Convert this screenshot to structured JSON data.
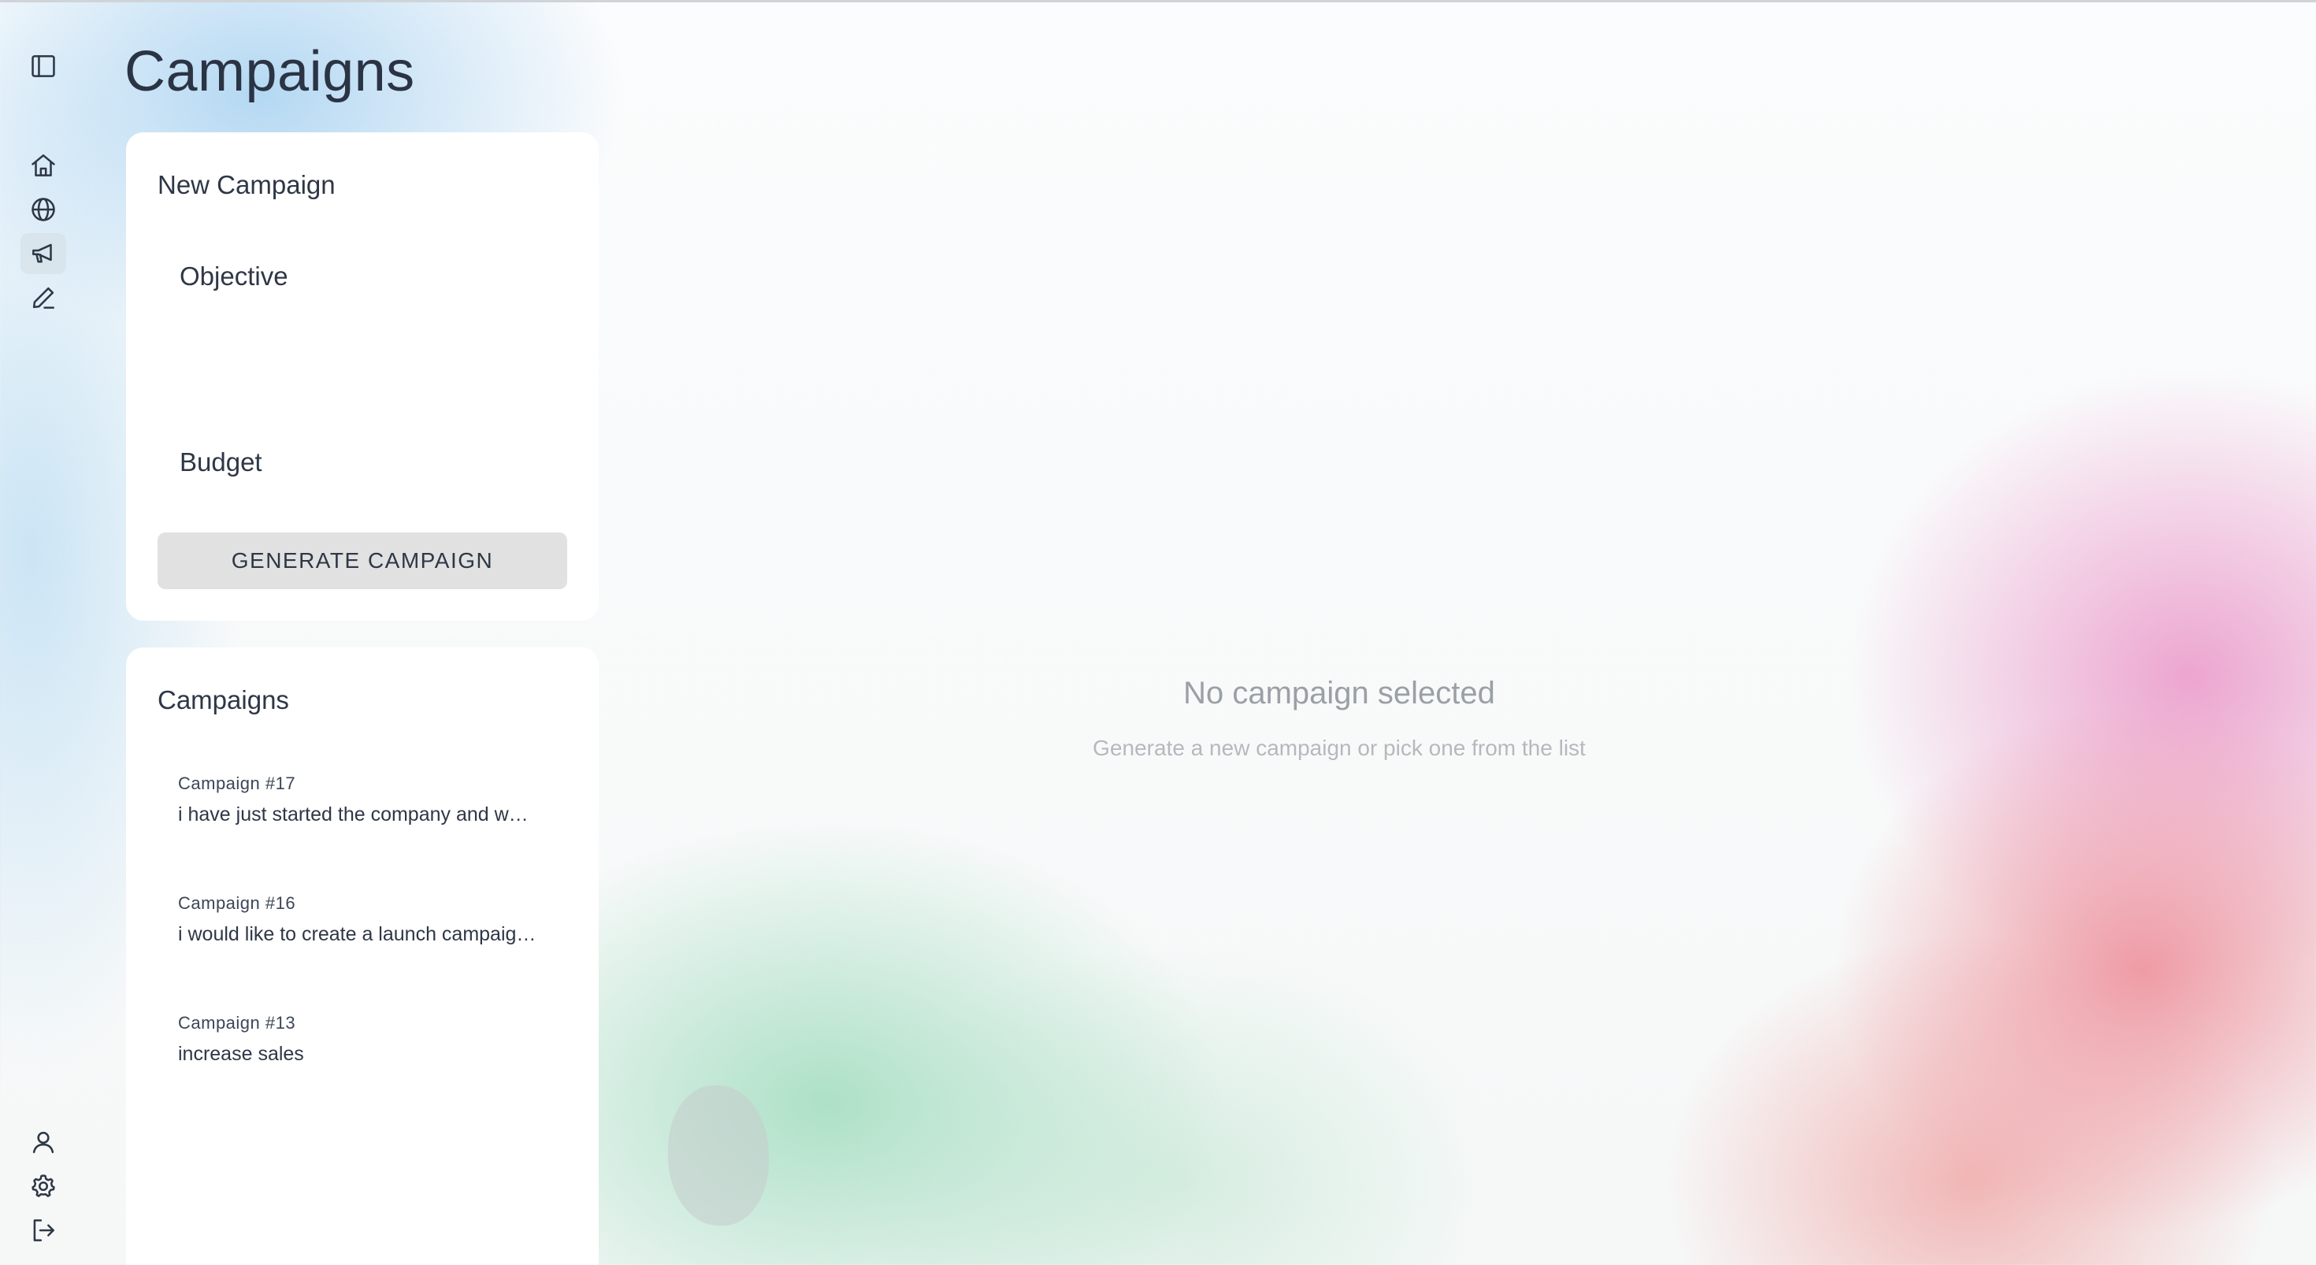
{
  "page": {
    "title": "Campaigns"
  },
  "sidebar": {
    "top_icons": [
      "sidebar-toggle-icon"
    ],
    "nav_icons": [
      "home-icon",
      "globe-icon",
      "megaphone-icon",
      "pen-icon"
    ],
    "active": "megaphone-icon",
    "bottom_icons": [
      "user-icon",
      "gear-icon",
      "logout-icon"
    ]
  },
  "new_campaign": {
    "title": "New Campaign",
    "objective_label": "Objective",
    "budget_label": "Budget",
    "generate_button": "GENERATE CAMPAIGN"
  },
  "campaigns": {
    "title": "Campaigns",
    "items": [
      {
        "name": "Campaign #17",
        "description": "i have just started the company and w…"
      },
      {
        "name": "Campaign #16",
        "description": "i would like to create a launch campaig…"
      },
      {
        "name": "Campaign #13",
        "description": "increase sales"
      }
    ]
  },
  "empty_state": {
    "title": "No campaign selected",
    "subtitle": "Generate a new campaign or pick one from the list"
  }
}
